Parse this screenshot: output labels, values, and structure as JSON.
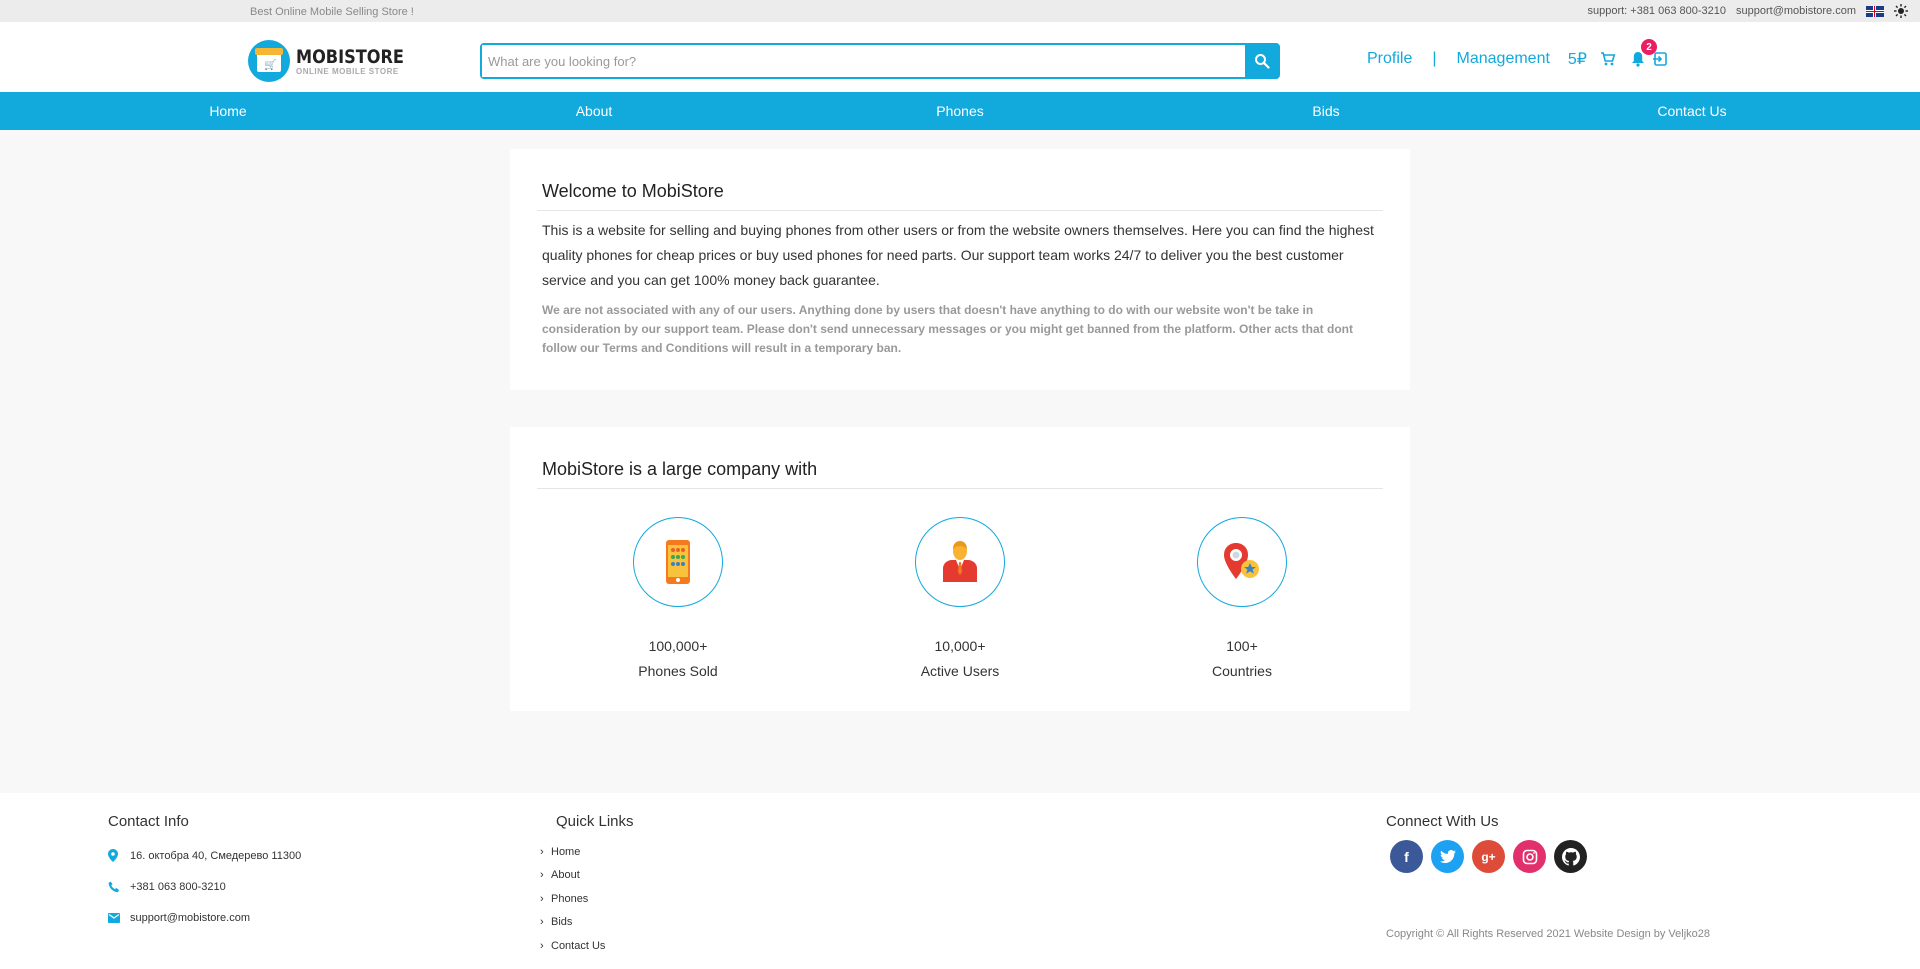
{
  "topbar": {
    "tagline": "Best Online Mobile Selling Store !",
    "support_phone": "support: +381 063 800-3210",
    "support_email": "support@mobistore.com"
  },
  "header": {
    "logo_name": "MOBISTORE",
    "logo_sub": "ONLINE MOBILE STORE",
    "search_placeholder": "What are you looking for?",
    "profile": "Profile",
    "separator": "|",
    "management": "Management",
    "coins": "5₽",
    "notification_count": "2"
  },
  "nav": {
    "items": [
      "Home",
      "About",
      "Phones",
      "Bids",
      "Contact Us"
    ]
  },
  "welcome": {
    "title": "Welcome to MobiStore",
    "body": "This is a website for selling and buying phones from other users or from the website owners themselves. Here you can find the highest quality phones for cheap prices or buy used phones for need parts. Our support team works 24/7 to deliver you the best customer service and you can get 100% money back guarantee.",
    "note": "We are not associated with any of our users. Anything done by users that doesn't have anything to do with our website won't be take in consideration by our support team. Please don't send unnecessary messages or you might get banned from the platform. Other acts that dont follow our Terms and Conditions will result in a temporary ban."
  },
  "company": {
    "title": "MobiStore is a large company with",
    "stats": [
      {
        "value": "100,000+",
        "label": "Phones Sold",
        "icon": "phone-icon"
      },
      {
        "value": "10,000+",
        "label": "Active Users",
        "icon": "user-icon"
      },
      {
        "value": "100+",
        "label": "Countries",
        "icon": "location-icon"
      }
    ]
  },
  "footer": {
    "contact_title": "Contact Info",
    "address": "16. октобра 40, Смедерево 11300",
    "phone": "+381 063 800-3210",
    "email": "support@mobistore.com",
    "links_title": "Quick Links",
    "links": [
      "Home",
      "About",
      "Phones",
      "Bids",
      "Contact Us"
    ],
    "connect_title": "Connect With Us",
    "copyright": "Copyright © All Rights Reserved 2021 Website Design by Veljko28"
  },
  "colors": {
    "accent": "#12a9dd",
    "badge": "#e91e63",
    "facebook": "#3b5998",
    "twitter": "#1da1f2",
    "google": "#dd4b39",
    "instagram": "#e1306c",
    "github": "#222222"
  }
}
